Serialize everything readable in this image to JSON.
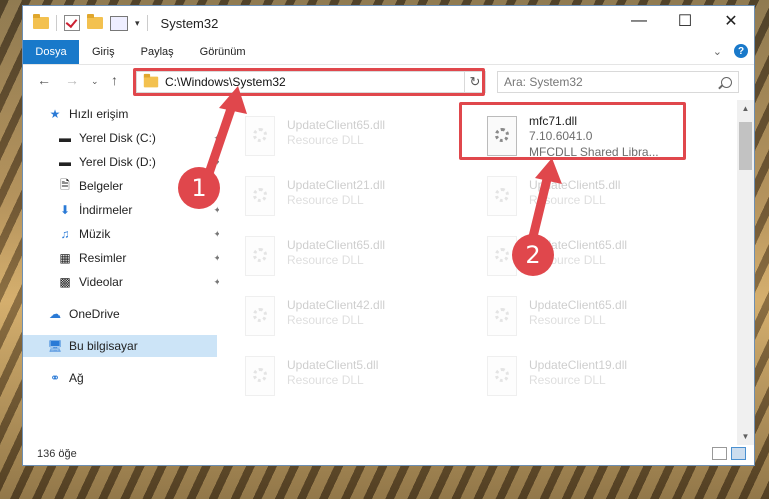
{
  "window": {
    "title": "System32"
  },
  "ribbon": {
    "file_tab": "Dosya",
    "tabs": [
      "Giriş",
      "Paylaş",
      "Görünüm"
    ]
  },
  "address": {
    "path": "C:\\Windows\\System32",
    "search_placeholder": "Ara: System32"
  },
  "nav": {
    "quick_access": "Hızlı erişim",
    "items": [
      {
        "label": "Yerel Disk (C:)",
        "icon": "drive-icon"
      },
      {
        "label": "Yerel Disk (D:)",
        "icon": "drive-icon"
      },
      {
        "label": "Belgeler",
        "icon": "documents-icon"
      },
      {
        "label": "İndirmeler",
        "icon": "download-icon"
      },
      {
        "label": "Müzik",
        "icon": "music-icon"
      },
      {
        "label": "Resimler",
        "icon": "pictures-icon"
      },
      {
        "label": "Videolar",
        "icon": "videos-icon"
      }
    ],
    "onedrive": "OneDrive",
    "this_pc": "Bu bilgisayar",
    "network": "Ağ"
  },
  "files": {
    "highlighted": {
      "name": "mfc71.dll",
      "version": "7.10.6041.0",
      "desc": "MFCDLL Shared Libra..."
    },
    "left_col": [
      {
        "name": "UpdateClient65.dll",
        "desc": "Resource DLL"
      },
      {
        "name": "UpdateClient21.dll",
        "desc": "Resource DLL"
      },
      {
        "name": "UpdateClient65.dll",
        "desc": "Resource DLL"
      },
      {
        "name": "UpdateClient42.dll",
        "desc": "Resource DLL"
      },
      {
        "name": "UpdateClient5.dll",
        "desc": "Resource DLL"
      }
    ],
    "right_col": [
      {
        "name": "UpdateClient5.dll",
        "desc": "Resource DLL"
      },
      {
        "name": "UpdateClient65.dll",
        "desc": "Resource DLL"
      },
      {
        "name": "UpdateClient65.dll",
        "desc": "Resource DLL"
      },
      {
        "name": "UpdateClient19.dll",
        "desc": "Resource DLL"
      }
    ]
  },
  "status": {
    "count": "136 öğe"
  },
  "annotations": {
    "step1": "1",
    "step2": "2",
    "color": "#e0474c"
  }
}
